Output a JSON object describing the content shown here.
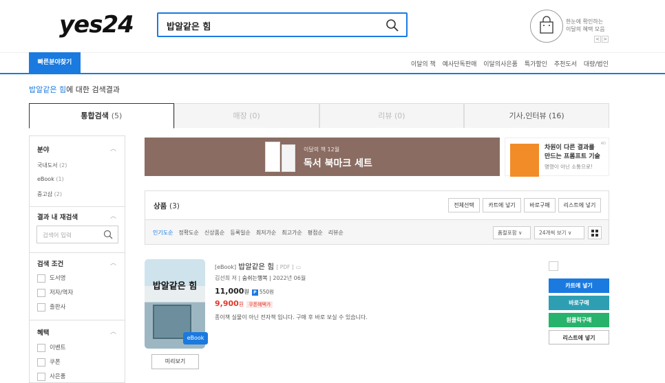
{
  "header": {
    "logo": "yes24",
    "search": {
      "value": "밥알같은 힘"
    },
    "promo": {
      "line1": "한눈에 확인하는",
      "line2": "이달의 혜택 모음",
      "prev": "<",
      "next": ">"
    }
  },
  "nav": {
    "quick_label": "빠른분야찾기",
    "links": [
      "이달의 책",
      "예사단독판매",
      "이달의사은품",
      "특가할인",
      "추천도서",
      "대량/법인"
    ]
  },
  "result": {
    "query": "밥알같은 힘",
    "suffix": "에 대한 검색결과"
  },
  "tabs": [
    {
      "label": "통합검색",
      "count": "(5)"
    },
    {
      "label": "매장",
      "count": "(0)"
    },
    {
      "label": "리뷰",
      "count": "(0)"
    },
    {
      "label": "기사,인터뷰",
      "count": "(16)"
    }
  ],
  "sidebar": {
    "category": {
      "title": "분야",
      "items": [
        {
          "label": "국내도서",
          "count": "(2)"
        },
        {
          "label": "eBook",
          "count": "(1)"
        },
        {
          "label": "중고샵",
          "count": "(2)"
        }
      ]
    },
    "research": {
      "title": "결과 내 재검색",
      "placeholder": "검색어 입력"
    },
    "conditions": {
      "title": "검색 조건",
      "items": [
        "도서명",
        "저자/역자",
        "출판사"
      ]
    },
    "benefits": {
      "title": "혜택",
      "items": [
        "이벤트",
        "쿠폰",
        "사은품"
      ]
    }
  },
  "banners": {
    "main": {
      "sub": "이달의 책 12월",
      "title": "독서 북마크 세트"
    },
    "side": {
      "line1": "차원이 다른 결과를",
      "line2": "만드는 프롬프트 기술",
      "line3": "명령이 아닌 소통으로!",
      "ad": "AD"
    }
  },
  "products": {
    "title": "상품",
    "count": "(3)",
    "buttons": [
      "전체선택",
      "카트에 넣기",
      "바로구매",
      "리스트에 넣기"
    ],
    "sorts": [
      "인기도순",
      "정확도순",
      "신상품순",
      "등록일순",
      "최저가순",
      "최고가순",
      "평점순",
      "리뷰순"
    ],
    "filter": "품절포함",
    "per_page": "24개씩 보기"
  },
  "item": {
    "format": "[eBook]",
    "title": "밥알같은 힘",
    "file_type": "[ PDF ]",
    "author": "김선희",
    "author_role": "저",
    "publisher": "숨쉬는행복",
    "date": "2022년 06월",
    "price": "11,000",
    "won": "원",
    "point_icon": "P",
    "points": "550원",
    "sale_price": "9,900",
    "coupon": "쿠폰혜택가",
    "desc": "종이책 실물이 아닌 전자책 입니다. 구매 후 바로 보실 수 있습니다.",
    "cover_title": "밥알같은 힘",
    "badge": "eBook",
    "preview": "미리보기",
    "actions": [
      {
        "label": "카트에 넣기",
        "color": "#1a7ae0"
      },
      {
        "label": "바로구매",
        "color": "#2e9fb3"
      },
      {
        "label": "원클릭구매",
        "color": "#27b36b"
      },
      {
        "label": "리스트에 넣기",
        "color": "#ffffff"
      }
    ]
  },
  "colors": {
    "accent": "#1a7ae0",
    "sale": "#e0372a"
  }
}
